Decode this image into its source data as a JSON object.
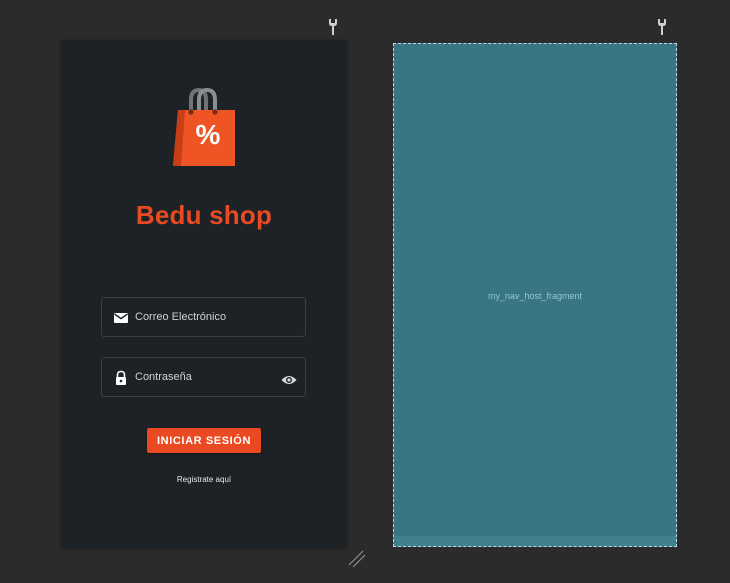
{
  "app": {
    "title": "Bedu shop",
    "logo_badge": "%"
  },
  "login": {
    "email_placeholder": "Correo Electrónico",
    "password_placeholder": "Contraseña",
    "submit_label": "INICIAR SESIÓN",
    "register_link": "Registrate aquí"
  },
  "blueprint": {
    "label": "my_nav_host_fragment"
  },
  "colors": {
    "brand": "#ea4a21",
    "phone_background": "#1d2226",
    "editor_background": "#2b2b2b",
    "blueprint_fill": "#3a7585"
  },
  "icons": {
    "email": "envelope-icon",
    "password": "lock-icon",
    "toggle_visibility": "eye-icon",
    "editor_handle": "wrench-icon",
    "resize": "resize-handle-icon"
  }
}
